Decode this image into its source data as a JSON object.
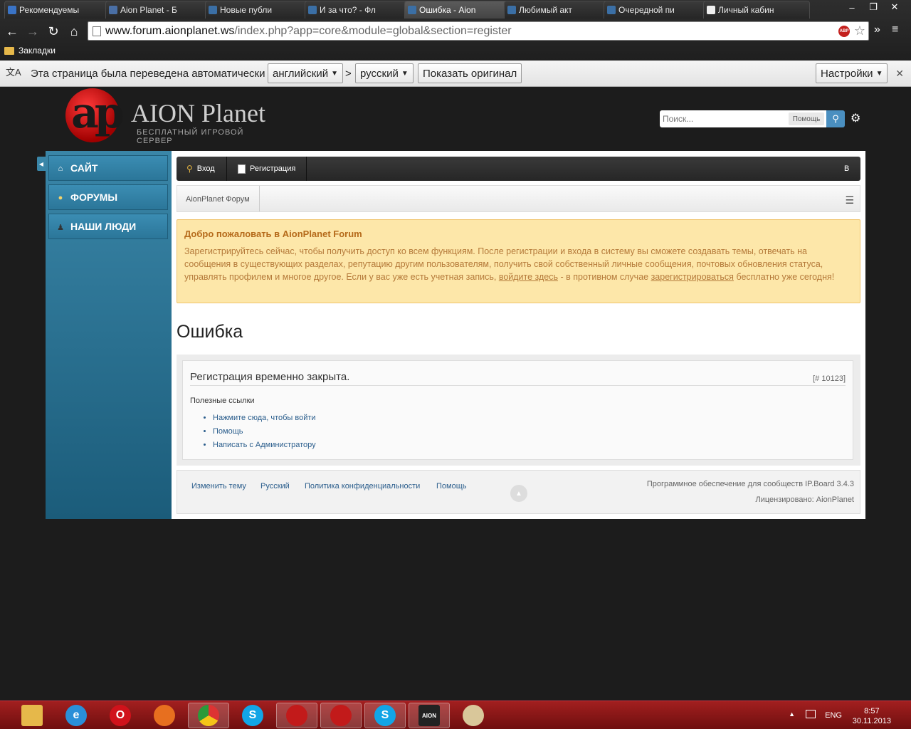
{
  "tabs": [
    {
      "label": "Рекомендуемы",
      "color": "#3a73c5"
    },
    {
      "label": "Aion Planet - Б",
      "color": "#4a6fa5"
    },
    {
      "label": "Новые публи",
      "color": "#3b6fa5"
    },
    {
      "label": "И за что? - Фл",
      "color": "#3b6fa5"
    },
    {
      "label": "Ошибка - Aion",
      "color": "#3b6fa5"
    },
    {
      "label": "Любимый акт",
      "color": "#3b6fa5"
    },
    {
      "label": "Очередной пи",
      "color": "#3b6fa5"
    },
    {
      "label": "Личный кабин",
      "color": "#eeeeee"
    }
  ],
  "window": {
    "minimize": "–",
    "maximize": "❐",
    "close": "✕"
  },
  "toolbar": {
    "url_host": "www.forum.aionplanet.ws",
    "url_path": "/index.php?app=core&module=global&section=register",
    "abp": "ABP",
    "more": "»",
    "menu": "≡"
  },
  "bookmarks": {
    "label": "Закладки"
  },
  "translate": {
    "message": "Эта страница была переведена автоматически",
    "from": "английский",
    "separator": ">",
    "to": "русский",
    "show_original": "Показать оригинал",
    "settings": "Настройки",
    "close": "✕"
  },
  "header": {
    "logo_ap": "ap",
    "logo_title": "AION Planet",
    "logo_sub": "БЕСПЛАТНЫЙ ИГРОВОЙ СЕРВЕР",
    "search_placeholder": "Поиск...",
    "search_help": "Помощь"
  },
  "sidebar": {
    "items": [
      {
        "label": "САЙТ"
      },
      {
        "label": "ФОРУМЫ"
      },
      {
        "label": "НАШИ ЛЮДИ"
      }
    ]
  },
  "userbar": {
    "login": "Вход",
    "register": "Регистрация",
    "right": "В"
  },
  "breadcrumb": {
    "forum": "AionPlanet Форум"
  },
  "welcome": {
    "title": "Добро пожаловать в AionPlanet Forum",
    "text_1": "Зарегистрируйтесь сейчас, чтобы получить доступ ко всем функциям. После регистрации и входа в систему вы сможете создавать темы, отвечать на сообщения в существующих разделах, репутацию другим пользователям, получить свой собственный личные сообщения, почтовых обновления статуса, управлять профилем и многое другое. Если у вас уже есть учетная запись, ",
    "link_login": "войдите здесь",
    "text_2": " - в противном случае ",
    "link_register": "зарегистрироваться",
    "text_3": " бесплатно уже сегодня!"
  },
  "error": {
    "title": "Ошибка",
    "message": "Регистрация временно закрыта.",
    "code": "[# 10123]",
    "useful_title": "Полезные ссылки",
    "links": [
      "Нажмите сюда, чтобы войти",
      "Помощь",
      "Написать с Администратору"
    ]
  },
  "footer": {
    "links": [
      "Изменить тему",
      "Русский",
      "Политика конфиденциальности",
      "Помощь"
    ],
    "powered": "Программное обеспечение для сообществ IP.Board 3.4.3",
    "licensed": "Лицензировано: AionPlanet"
  },
  "taskbar": {
    "lang": "ENG",
    "time": "8:57",
    "date": "30.11.2013"
  }
}
